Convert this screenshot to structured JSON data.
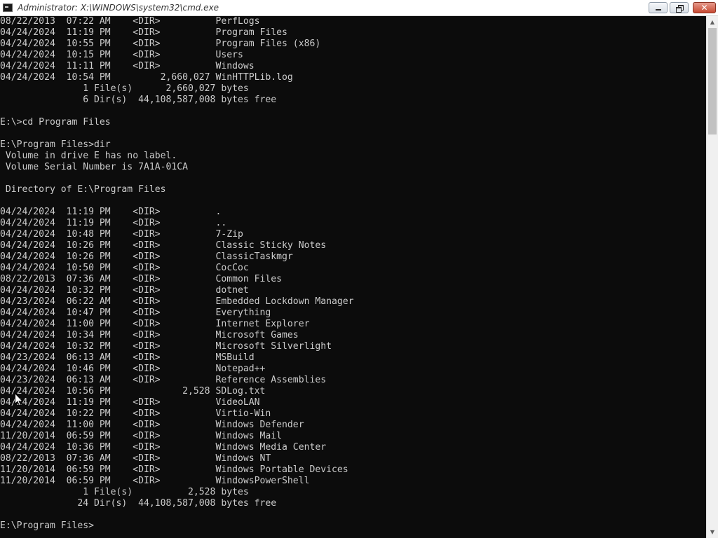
{
  "window": {
    "title": "Administrator: X:\\WINDOWS\\system32\\cmd.exe",
    "icon": "cmd-icon",
    "controls": {
      "minimize": "minimize-icon",
      "maximize": "restore-icon",
      "close": "✕"
    }
  },
  "colors": {
    "console_background": "#0c0c0c",
    "console_text": "#cccccc",
    "titlebar_background": "#ffffff",
    "close_button": "#c74a32"
  },
  "console": {
    "lines": [
      "08/22/2013  07:22 AM    <DIR>          PerfLogs",
      "04/24/2024  11:19 PM    <DIR>          Program Files",
      "04/24/2024  10:55 PM    <DIR>          Program Files (x86)",
      "04/24/2024  10:15 PM    <DIR>          Users",
      "04/24/2024  11:11 PM    <DIR>          Windows",
      "04/24/2024  10:54 PM         2,660,027 WinHTTPLib.log",
      "               1 File(s)      2,660,027 bytes",
      "               6 Dir(s)  44,108,587,008 bytes free",
      "",
      "E:\\>cd Program Files",
      "",
      "E:\\Program Files>dir",
      " Volume in drive E has no label.",
      " Volume Serial Number is 7A1A-01CA",
      "",
      " Directory of E:\\Program Files",
      "",
      "04/24/2024  11:19 PM    <DIR>          .",
      "04/24/2024  11:19 PM    <DIR>          ..",
      "04/24/2024  10:48 PM    <DIR>          7-Zip",
      "04/24/2024  10:26 PM    <DIR>          Classic Sticky Notes",
      "04/24/2024  10:26 PM    <DIR>          ClassicTaskmgr",
      "04/24/2024  10:50 PM    <DIR>          CocCoc",
      "08/22/2013  07:36 AM    <DIR>          Common Files",
      "04/24/2024  10:32 PM    <DIR>          dotnet",
      "04/23/2024  06:22 AM    <DIR>          Embedded Lockdown Manager",
      "04/24/2024  10:47 PM    <DIR>          Everything",
      "04/24/2024  11:00 PM    <DIR>          Internet Explorer",
      "04/24/2024  10:34 PM    <DIR>          Microsoft Games",
      "04/24/2024  10:32 PM    <DIR>          Microsoft Silverlight",
      "04/23/2024  06:13 AM    <DIR>          MSBuild",
      "04/24/2024  10:46 PM    <DIR>          Notepad++",
      "04/23/2024  06:13 AM    <DIR>          Reference Assemblies",
      "04/24/2024  10:56 PM             2,528 SDLog.txt",
      "04/24/2024  11:19 PM    <DIR>          VideoLAN",
      "04/24/2024  10:22 PM    <DIR>          Virtio-Win",
      "04/24/2024  11:00 PM    <DIR>          Windows Defender",
      "11/20/2014  06:59 PM    <DIR>          Windows Mail",
      "04/24/2024  10:36 PM    <DIR>          Windows Media Center",
      "08/22/2013  07:36 AM    <DIR>          Windows NT",
      "11/20/2014  06:59 PM    <DIR>          Windows Portable Devices",
      "11/20/2014  06:59 PM    <DIR>          WindowsPowerShell",
      "               1 File(s)          2,528 bytes",
      "              24 Dir(s)  44,108,587,008 bytes free",
      "",
      "E:\\Program Files>"
    ]
  },
  "scrollbar": {
    "up_arrow": "▲",
    "down_arrow": "▼"
  },
  "pointer": "mouse-pointer-icon"
}
